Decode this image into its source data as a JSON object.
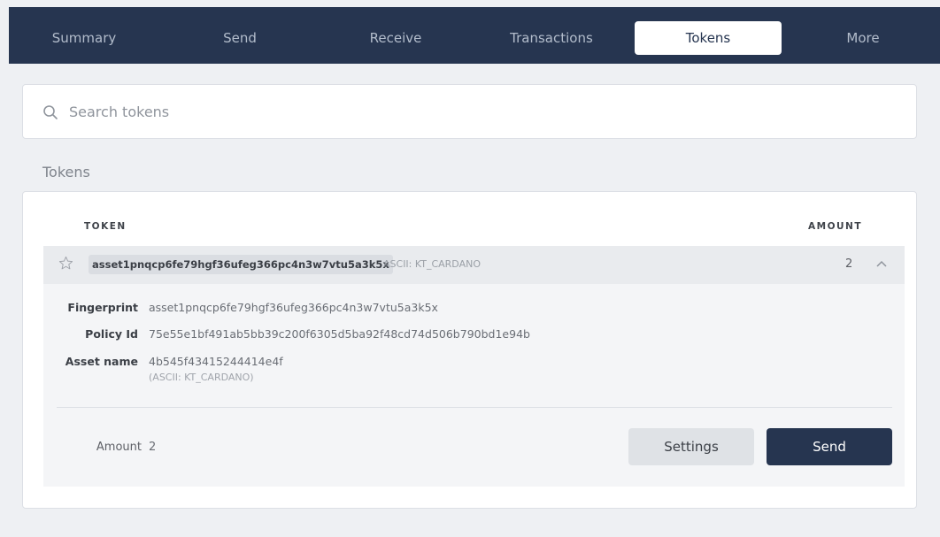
{
  "nav": {
    "tabs": [
      {
        "label": "Summary",
        "active": false
      },
      {
        "label": "Send",
        "active": false
      },
      {
        "label": "Receive",
        "active": false
      },
      {
        "label": "Transactions",
        "active": false
      },
      {
        "label": "Tokens",
        "active": true
      },
      {
        "label": "More",
        "active": false
      }
    ]
  },
  "search": {
    "placeholder": "Search tokens",
    "value": "",
    "icon": "search-icon"
  },
  "section": {
    "title": "Tokens"
  },
  "table": {
    "headers": {
      "token": "TOKEN",
      "amount": "AMOUNT"
    },
    "rows": [
      {
        "token_id": "asset1pnqcp6fe79hgf36ufeg366pc4n3w7vtu5a3k5x",
        "ascii": "ASCII: KT_CARDANO",
        "amount": "2",
        "favorite": false,
        "expanded": true,
        "details": {
          "fingerprint_label": "Fingerprint",
          "fingerprint": "asset1pnqcp6fe79hgf36ufeg366pc4n3w7vtu5a3k5x",
          "policy_label": "Policy Id",
          "policy_id": "75e55e1bf491ab5bb39c200f6305d5ba92f48cd74d506b790bd1e94b",
          "asset_name_label": "Asset name",
          "asset_name": "4b545f43415244414e4f",
          "asset_name_ascii": "(ASCII: KT_CARDANO)",
          "amount_label": "Amount",
          "amount": "2"
        },
        "actions": {
          "settings": "Settings",
          "send": "Send"
        }
      }
    ]
  },
  "colors": {
    "nav_bg": "#263550",
    "primary_button": "#263550",
    "page_bg": "#eef0f3"
  }
}
